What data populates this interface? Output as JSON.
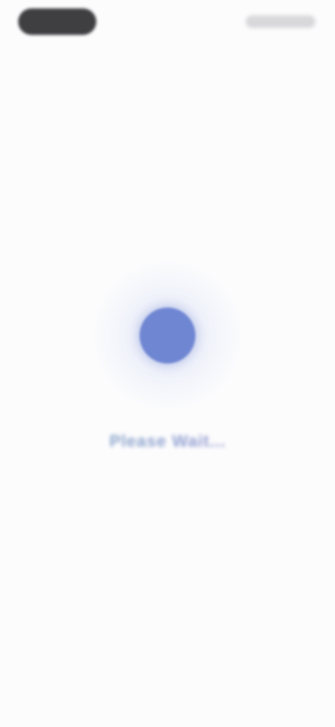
{
  "status_bar": {
    "left_label": "",
    "right_label": ""
  },
  "loader": {
    "icon": "loading-dot-icon",
    "message": "Please Wait..."
  },
  "colors": {
    "background": "#fcfcfd",
    "accent": "#6f86d2",
    "pill": "#3f3f42",
    "message_gradient_start": "#86a9c6",
    "message_gradient_end": "#a08fd0"
  }
}
